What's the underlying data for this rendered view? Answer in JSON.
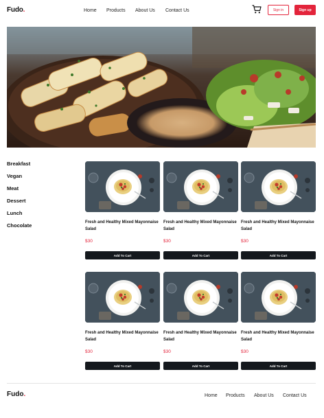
{
  "header": {
    "logo": "Fudo",
    "logo_dot": ".",
    "nav": [
      "Home",
      "Products",
      "About Us",
      "Contact Us"
    ],
    "signin_label": "Sign in",
    "signup_label": "Sign up",
    "cart_icon": "cart-icon"
  },
  "categories": [
    "Breakfast",
    "Vegan",
    "Meat",
    "Dessert",
    "Lunch",
    "Chocolate"
  ],
  "products": [
    {
      "name": "Fresh and Healthy Mixed Mayonnaise Salad",
      "price": "$30",
      "button": "Add To Cart"
    },
    {
      "name": "Fresh and Healthy Mixed Mayonnaise Salad",
      "price": "$30",
      "button": "Add To Cart"
    },
    {
      "name": "Fresh and Healthy Mixed Mayonnaise Salad",
      "price": "$30",
      "button": "Add To Cart"
    },
    {
      "name": "Fresh and Healthy Mixed Mayonnaise Salad",
      "price": "$30",
      "button": "Add To Cart"
    },
    {
      "name": "Fresh and Healthy Mixed Mayonnaise Salad",
      "price": "$30",
      "button": "Add To Cart"
    },
    {
      "name": "Fresh and Healthy Mixed Mayonnaise Salad",
      "price": "$30",
      "button": "Add To Cart"
    }
  ],
  "footer": {
    "logo": "Fudo",
    "logo_dot": ".",
    "nav": [
      "Home",
      "Products",
      "About Us",
      "Contact Us"
    ]
  },
  "colors": {
    "accent": "#e3243b",
    "button_dark": "#14181d"
  }
}
